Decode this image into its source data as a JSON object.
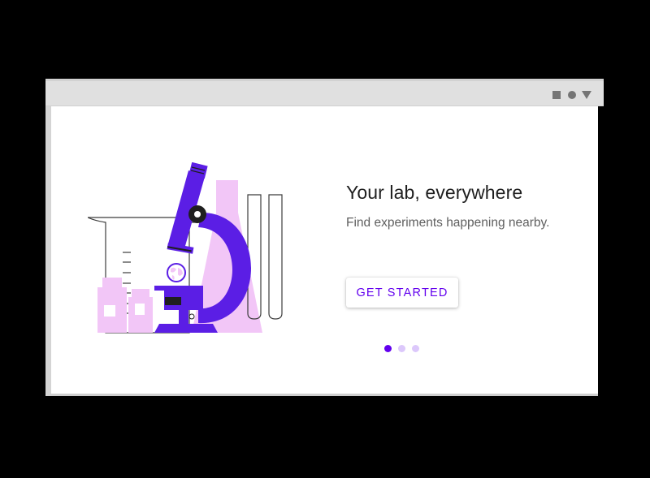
{
  "window": {
    "controls": [
      "square-icon",
      "circle-icon",
      "triangle-icon"
    ]
  },
  "onboarding": {
    "title": "Your lab, everywhere",
    "subtitle": "Find experiments happening nearby.",
    "cta_label": "GET STARTED",
    "page_indicator": {
      "total": 3,
      "current": 1
    },
    "illustration": "lab-microscope-illustration"
  },
  "colors": {
    "primary": "#6200ee",
    "primary_light": "#dcc8fb",
    "illustration_pink": "#f2c6f7",
    "illustration_purple": "#5b1ee5",
    "text_primary": "#1f1f1f",
    "text_secondary": "#5f5f5f",
    "titlebar": "#e0e0e0",
    "control_icon": "#757575"
  }
}
